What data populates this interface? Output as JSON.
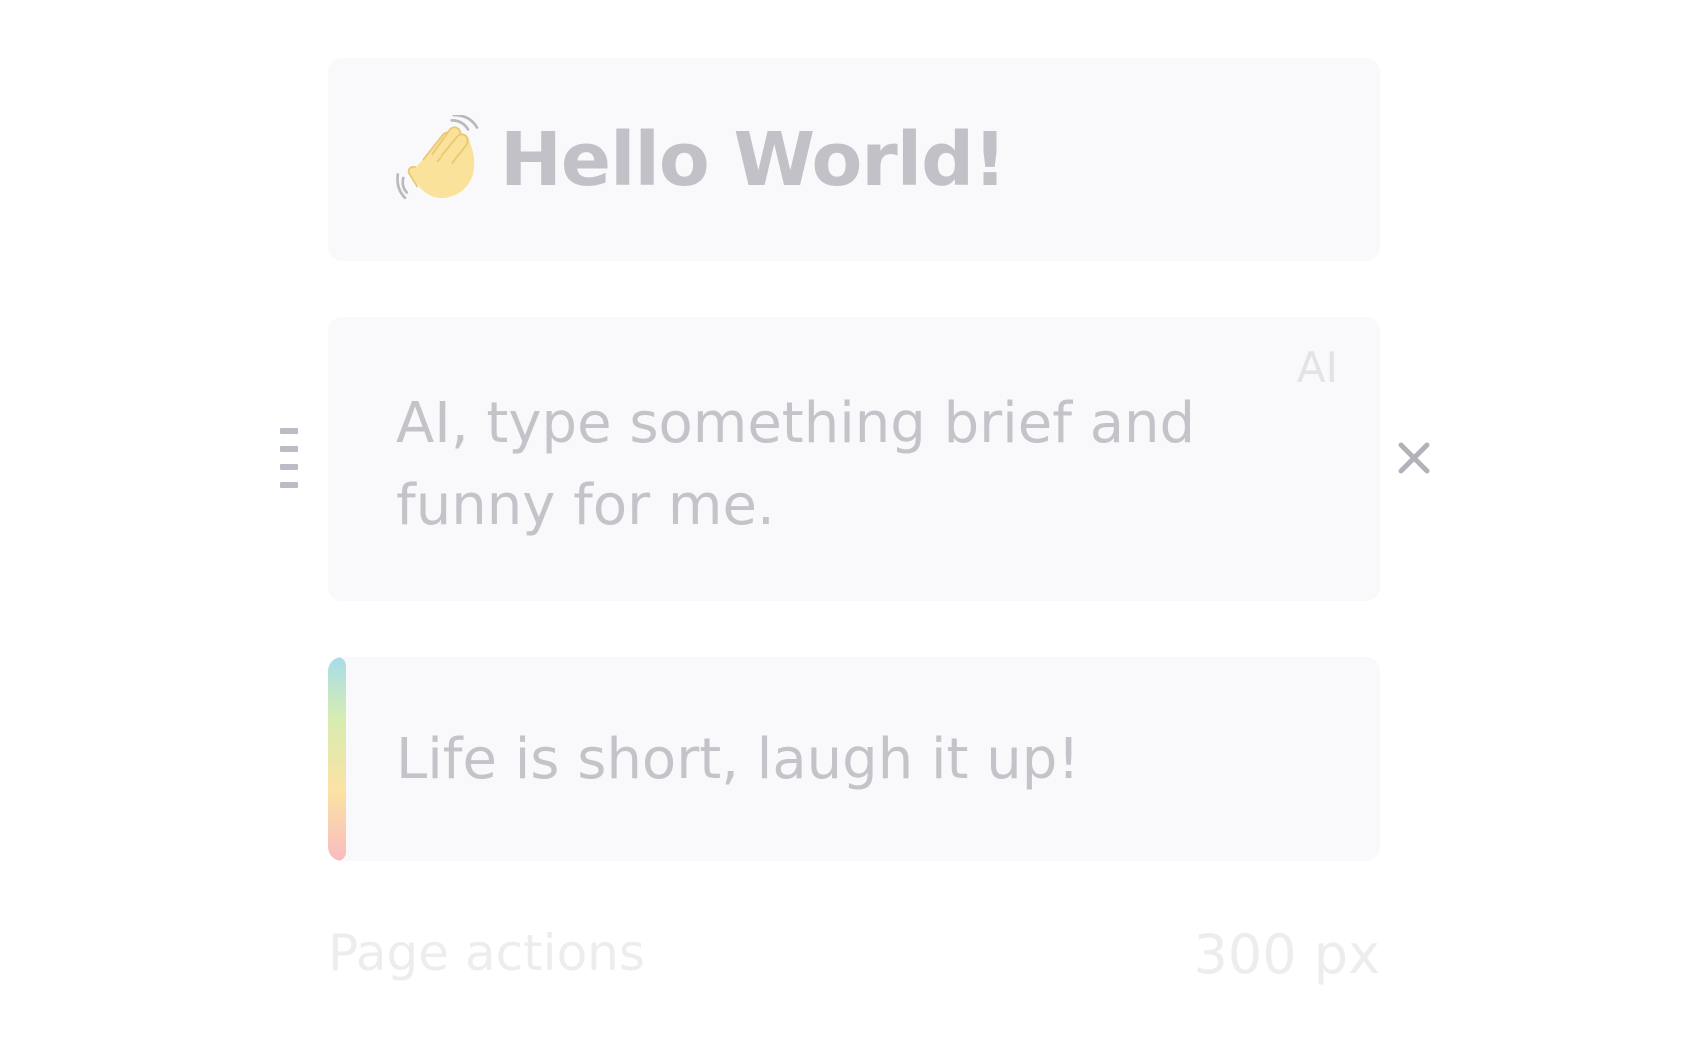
{
  "blocks": {
    "title": {
      "icon": "waving-hand-icon",
      "text": "Hello World!"
    },
    "prompt": {
      "tag": "AI",
      "text": "AI, type something brief and funny for me."
    },
    "response": {
      "text": "Life is short, laugh it up!"
    }
  },
  "controls": {
    "drag_handle_icon": "drag-handle-icon",
    "close_icon": "close-icon"
  },
  "footer": {
    "label": "Page actions",
    "value": "300 px"
  },
  "colors": {
    "card_background": "#f9f9fb",
    "text_muted": "#c4c3ca",
    "footer_text": "#ededf0",
    "gradient": [
      "#a6dcea",
      "#d6ecb1",
      "#fbe3a4",
      "#f9bcc0"
    ]
  }
}
